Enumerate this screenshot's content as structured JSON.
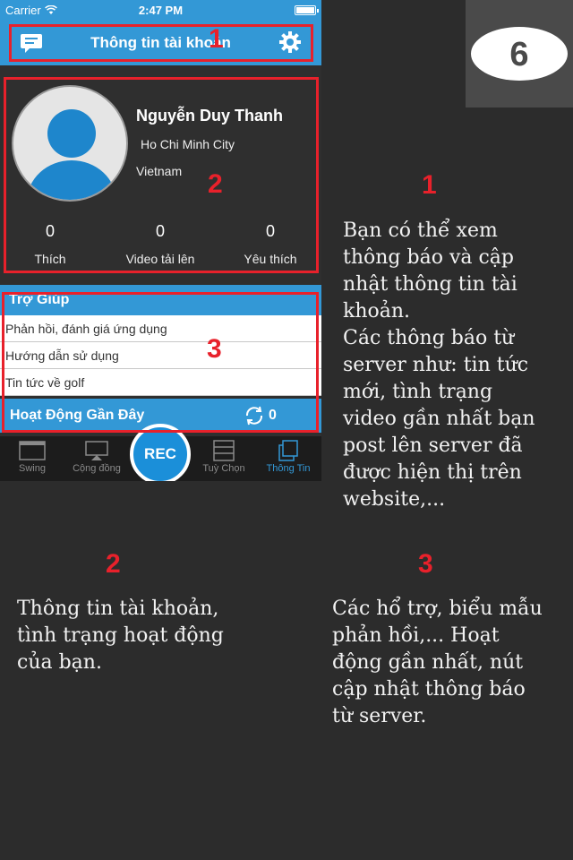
{
  "status_bar": {
    "carrier": "Carrier",
    "time": "2:47 PM"
  },
  "nav": {
    "title": "Thông tin tài khoản"
  },
  "profile": {
    "name": "Nguyễn Duy Thanh",
    "city": "Ho Chi Minh City",
    "country": "Vietnam",
    "stats": [
      {
        "value": "0",
        "label": "Thích"
      },
      {
        "value": "0",
        "label": "Video tải lên"
      },
      {
        "value": "0",
        "label": "Yêu thích"
      }
    ]
  },
  "help": {
    "header": "Trợ Giúp",
    "items": [
      "Phản hồi, đánh giá ứng dụng",
      "Hướng dẫn sử dụng",
      "Tin tức về golf"
    ]
  },
  "recent": {
    "label": "Hoạt Động Gần Đây",
    "count": "0"
  },
  "tabbar": {
    "tabs": [
      "Swing",
      "Cộng đồng",
      "Tuỳ Chọn",
      "Thông Tin"
    ],
    "rec_label": "REC"
  },
  "annotations": {
    "markers": [
      "1",
      "2",
      "3"
    ],
    "step_number": "6",
    "desc_1": "Bạn có thể xem\nthông báo và cập\nnhật thông tin tài\nkhoản.\nCác thông báo từ\nserver như: tin tức\nmới, tình trạng\nvideo gần nhất bạn\npost lên server đã\nđược hiện thị trên\nwebsite,...",
    "desc_2": "Thông tin tài khoản,\ntình trạng hoạt động\ncủa bạn.",
    "desc_3": "Các hổ trợ, biểu mẫu\nphản hồi,... Hoạt\nđộng gần nhất, nút\ncập nhật thông báo\ntừ server."
  },
  "colors": {
    "accent": "#3398d6",
    "annotation_red": "#e8212b",
    "background": "#2c2c2c"
  },
  "icons": [
    "wifi-icon",
    "battery-icon",
    "message-icon",
    "gear-icon",
    "avatar-icon",
    "sync-icon",
    "swing-icon",
    "community-icon",
    "options-icon",
    "info-icon"
  ]
}
